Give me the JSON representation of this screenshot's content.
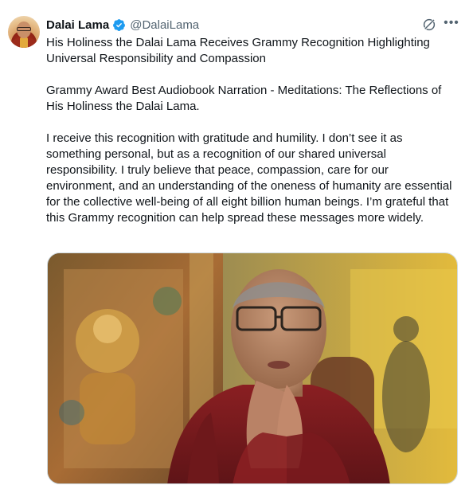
{
  "author": {
    "display_name": "Dalai Lama",
    "handle": "@DalaiLama",
    "verified": true,
    "verified_color": "#1d9bf0",
    "avatar_icon": "avatar-portrait"
  },
  "actions": {
    "grok_icon": "grok-icon",
    "more_icon": "more-dots-icon",
    "more_glyph": "•••"
  },
  "tweet": {
    "paragraphs": [
      "His Holiness the Dalai Lama Receives Grammy Recognition Highlighting Universal Responsibility and Compassion",
      "Grammy Award Best Audiobook Narration - Meditations: The Reflections of His Holiness the Dalai Lama.",
      "I receive this recognition with gratitude and humility. I don’t see it as something personal, but as a recognition of our shared universal responsibility. I truly believe that peace, compassion, care for our environment, and an understanding of the oneness of humanity are essential for the collective well-being of all eight billion human beings. I’m grateful that this Grammy recognition can help spread these messages more widely."
    ]
  },
  "media": {
    "kind": "photo"
  },
  "colors": {
    "text": "#0f1419",
    "secondary": "#536471",
    "accent": "#1d9bf0"
  }
}
